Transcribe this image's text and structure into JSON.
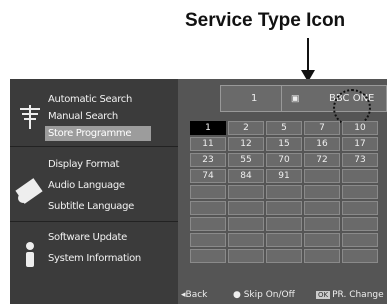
{
  "caption": "Service Type Icon",
  "menu": {
    "groups": [
      {
        "icon": "antenna-icon",
        "items": [
          {
            "label": "Automatic Search"
          },
          {
            "label": "Manual Search"
          },
          {
            "label": "Store Programme",
            "selected": true
          }
        ]
      },
      {
        "icon": "display-icon",
        "items": [
          {
            "label": "Display Format"
          },
          {
            "label": "Audio Language"
          },
          {
            "label": "Subtitle Language"
          }
        ]
      },
      {
        "icon": "info-icon",
        "items": [
          {
            "label": "Software Update"
          },
          {
            "label": "System Information"
          }
        ]
      }
    ]
  },
  "topbar": {
    "number": "1",
    "service_icon": "tv-icon",
    "channel_name": "BBC ONE"
  },
  "grid": {
    "rows": [
      [
        "1",
        "2",
        "5",
        "7",
        "10"
      ],
      [
        "11",
        "12",
        "15",
        "16",
        "17"
      ],
      [
        "23",
        "55",
        "70",
        "72",
        "73"
      ],
      [
        "74",
        "84",
        "91",
        "",
        ""
      ],
      [
        "",
        "",
        "",
        "",
        ""
      ],
      [
        "",
        "",
        "",
        "",
        ""
      ],
      [
        "",
        "",
        "",
        "",
        ""
      ],
      [
        "",
        "",
        "",
        "",
        ""
      ],
      [
        "",
        "",
        "",
        "",
        ""
      ]
    ],
    "active": "1"
  },
  "footer": {
    "back": "Back",
    "skip": "Skip On/Off",
    "pr_change_key": "OK",
    "pr_change": "PR. Change"
  }
}
